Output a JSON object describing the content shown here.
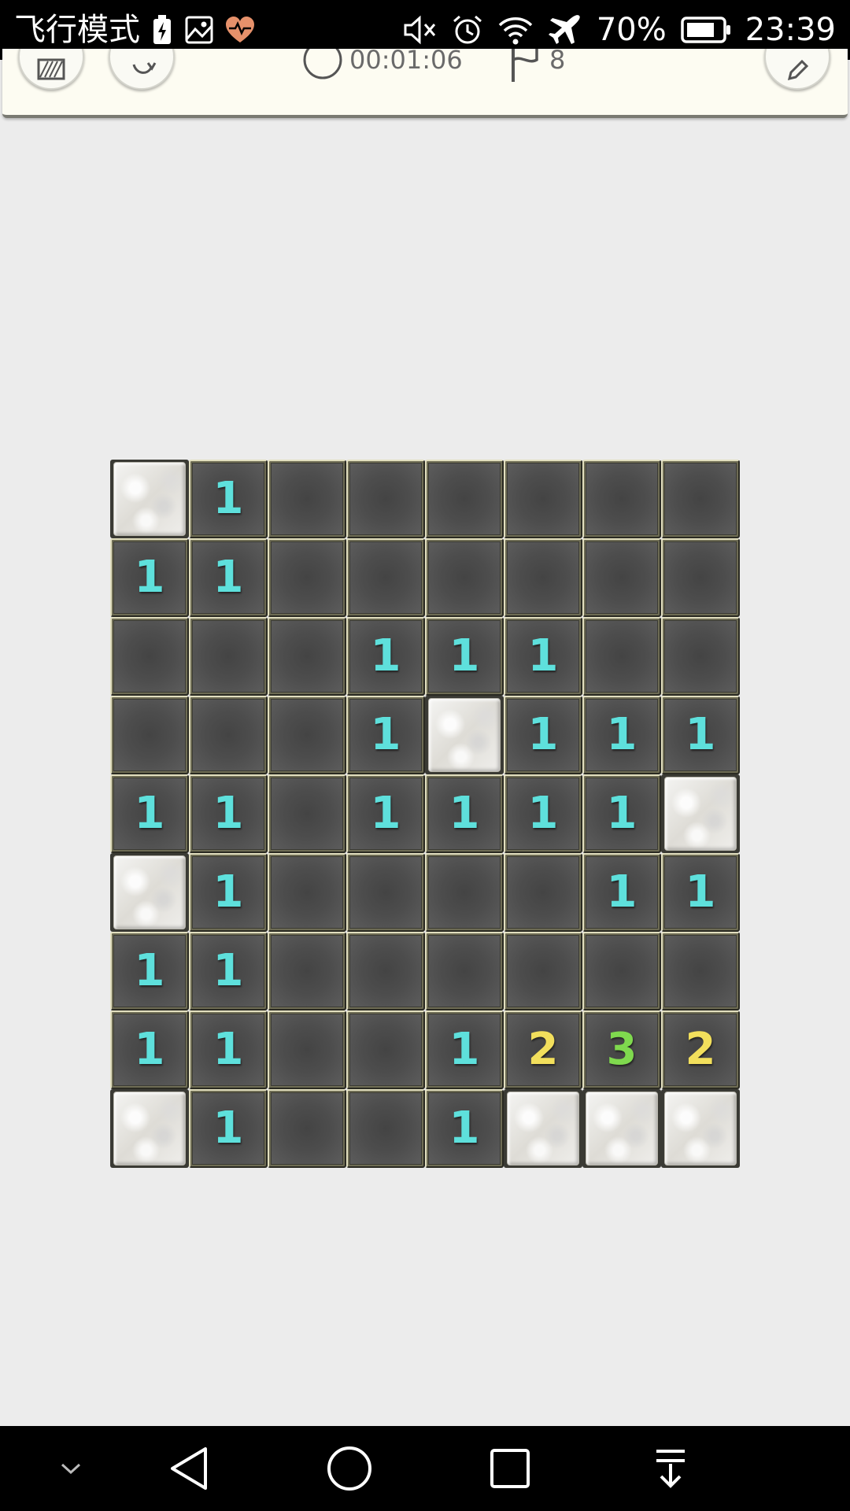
{
  "status_bar": {
    "mode_text": "飞行模式",
    "battery_percent": "70%",
    "time": "23:39",
    "icons": [
      "battery-charging-icon",
      "image-icon",
      "heart-rate-icon",
      "mute-icon",
      "alarm-icon",
      "wifi-icon",
      "airplane-icon",
      "battery-icon"
    ]
  },
  "toolbar": {
    "timer": "00:01:06",
    "flags": "8",
    "icons": [
      "grid-icon",
      "restart-icon",
      "clock-icon",
      "flag-icon",
      "edit-icon"
    ]
  },
  "board": {
    "columns": 8,
    "rows": 9,
    "cells": [
      [
        "#",
        "1",
        "",
        "",
        "",
        "",
        "",
        ""
      ],
      [
        "1",
        "1",
        "",
        "",
        "",
        "",
        "",
        ""
      ],
      [
        "",
        "",
        "",
        "1",
        "1",
        "1",
        "",
        ""
      ],
      [
        "",
        "",
        "",
        "1",
        "#",
        "1",
        "1",
        "1"
      ],
      [
        "1",
        "1",
        "",
        "1",
        "1",
        "1",
        "1",
        "#"
      ],
      [
        "#",
        "1",
        "",
        "",
        "",
        "",
        "1",
        "1"
      ],
      [
        "1",
        "1",
        "",
        "",
        "",
        "",
        "",
        ""
      ],
      [
        "1",
        "1",
        "",
        "",
        "1",
        "2",
        "3",
        "2"
      ],
      [
        "#",
        "1",
        "",
        "",
        "1",
        "#",
        "#",
        "#"
      ]
    ],
    "legend": {
      "#": "covered",
      "": "revealed-empty"
    },
    "number_colors": {
      "1": "#5ee0dc",
      "2": "#f2df5c",
      "3": "#7fd94e"
    }
  },
  "nav_bar": {
    "icons": [
      "chevron-down-icon",
      "back-icon",
      "home-icon",
      "recents-icon",
      "notification-pull-icon"
    ]
  }
}
